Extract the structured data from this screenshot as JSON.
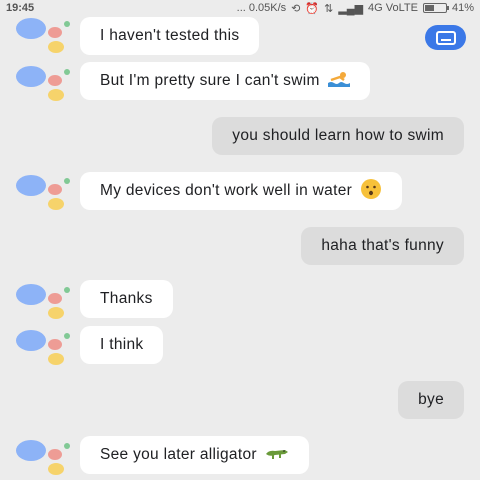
{
  "status_bar": {
    "time": "19:45",
    "network_speed": "... 0.05K/s",
    "signal_labels": "4G VoLTE",
    "battery": "41%"
  },
  "keyboard_button": {
    "icon": "keyboard-icon"
  },
  "conversation": [
    {
      "sender": "assistant",
      "text": "I haven't tested this"
    },
    {
      "sender": "assistant",
      "text": "But I'm pretty sure I can't swim",
      "emoji": "swimmer-icon"
    },
    {
      "sender": "user",
      "text": "you should learn how to swim"
    },
    {
      "sender": "assistant",
      "text": "My devices don't work well in water",
      "emoji": "hushed-face-icon"
    },
    {
      "sender": "user",
      "text": "haha that's funny"
    },
    {
      "sender": "assistant",
      "text": "Thanks"
    },
    {
      "sender": "assistant",
      "text": "I think"
    },
    {
      "sender": "user",
      "text": "bye"
    },
    {
      "sender": "assistant",
      "text": "See you later alligator",
      "emoji": "crocodile-icon"
    }
  ],
  "colors": {
    "background": "#ececec",
    "assistant_bubble": "#ffffff",
    "user_bubble": "#dcdcdc",
    "accent_blue": "#3b78e7"
  }
}
